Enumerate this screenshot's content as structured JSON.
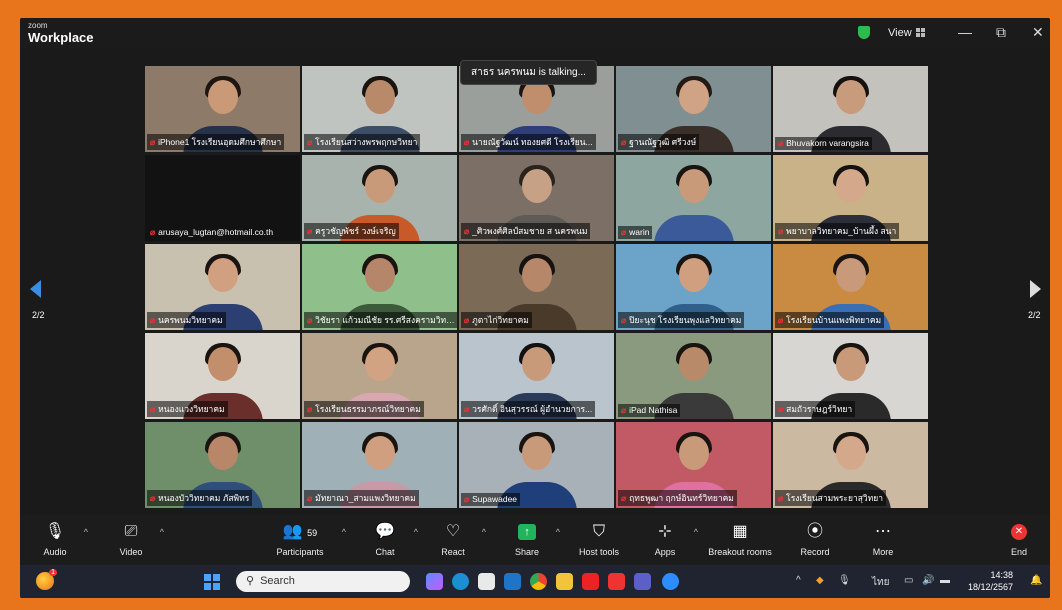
{
  "window": {
    "logo_small": "zoom",
    "logo_big": "Workplace",
    "view_label": "View",
    "minimize": "—",
    "restore": "⧉",
    "close": "✕"
  },
  "speaker": {
    "text": "สาธร นครพนม is talking..."
  },
  "pager": {
    "left": "2/2",
    "right": "2/2"
  },
  "participants": [
    {
      "name": "iPhone1 โรงเรียนอุดมศึกษาศึกษา",
      "bg": "#8d7a68",
      "body": "#26324a",
      "hair": "#1d1512",
      "skin": "#c99978"
    },
    {
      "name": "โรงเรียนสว่างพรพฤกษวิทยา",
      "bg": "#bfc4c0",
      "body": "#3d4f66",
      "hair": "#1a1411",
      "skin": "#b88a6a"
    },
    {
      "name": "นายณัฐวัฒน์ ทองยศดี โรงเรียน...",
      "bg": "#9a9f9c",
      "body": "#2e3f78",
      "hair": "#1a1411",
      "skin": "#c08e6d"
    },
    {
      "name": "ฐานณัฐวุฒิ ศรีวงษ์",
      "bg": "#7f8f92",
      "body": "#3b2f2a",
      "hair": "#241a15",
      "skin": "#d0a385"
    },
    {
      "name": "Bhuvakorn varangsira",
      "bg": "#c4c2bc",
      "body": "#2b2b30",
      "hair": "#15110f",
      "skin": "#c79b7c"
    },
    {
      "name": "arusaya_lugtan@hotmail.co.th",
      "bg": "#121212",
      "body": "#121212",
      "hair": "#121212",
      "skin": "#121212"
    },
    {
      "name": "ครูวชัญพัชร์ วงษ์เจริญ",
      "bg": "#a9b3ad",
      "body": "#c85a2a",
      "hair": "#1a1411",
      "skin": "#c99a7a"
    },
    {
      "name": "_ศิวพงศ์ศิลป์สมชาย ส นครพนม",
      "bg": "#7c6f66",
      "body": "#5e5a56",
      "hair": "#2a221d",
      "skin": "#c7a185"
    },
    {
      "name": "warin",
      "bg": "#8da6a0",
      "body": "#3a5a9a",
      "hair": "#1a1411",
      "skin": "#c99a7a"
    },
    {
      "name": "พยาบาลวิทยาคม_บ้านผึ้ง สนา",
      "bg": "#c9b188",
      "body": "#2a2f3a",
      "hair": "#15110f",
      "skin": "#d4a98b"
    },
    {
      "name": "นครพนมวิทยาคม",
      "bg": "#c9c1b0",
      "body": "#2b3f73",
      "hair": "#1a1411",
      "skin": "#d0a080"
    },
    {
      "name": "วิชัยรา แก้วมณีชัย รร.ศรีสงครามวิทยาคม",
      "bg": "#8fbf8a",
      "body": "#3c5b3a",
      "hair": "#1a1411",
      "skin": "#b5866a"
    },
    {
      "name": "ภูตาไก่วิทยาคม",
      "bg": "#7b6a56",
      "body": "#4a3a2a",
      "hair": "#171210",
      "skin": "#b7876a"
    },
    {
      "name": "ปิยะนุช โรงเรียนพุงแลวิทยาคม",
      "bg": "#6ba4c8",
      "body": "#2f5f8a",
      "hair": "#1a1411",
      "skin": "#cf9f80"
    },
    {
      "name": "โรงเรียนบ้านแพงพิทยาคม",
      "bg": "#c98a42",
      "body": "#3a6fb5",
      "hair": "#1a1411",
      "skin": "#c99a7a"
    },
    {
      "name": "หนองแวงวิทยาคม",
      "bg": "#d9d4cc",
      "body": "#6a2f2a",
      "hair": "#1a1411",
      "skin": "#c28e6c"
    },
    {
      "name": "โรงเรียนธรรมาภรณ์วิทยาคม",
      "bg": "#b8a58c",
      "body": "#d9a7b0",
      "hair": "#1a1411",
      "skin": "#d1a383"
    },
    {
      "name": "วรศักดิ์ อินสุวรรณ์ ผู้อำนวยการ...",
      "bg": "#b9c4cc",
      "body": "#2a3a5a",
      "hair": "#111",
      "skin": "#c99a7a"
    },
    {
      "name": "iPad Nathisa",
      "bg": "#8a9a7f",
      "body": "#3a3a3a",
      "hair": "#1a1411",
      "skin": "#b88a6a"
    },
    {
      "name": "สมถัวราษฎร์วิทยา",
      "bg": "#d8d6d2",
      "body": "#2a2a2a",
      "hair": "#1a1411",
      "skin": "#c99a7a"
    },
    {
      "name": "หนองบัววิทยาคม ภัสพิทร",
      "bg": "#6f8f6a",
      "body": "#2f4e7a",
      "hair": "#1a1411",
      "skin": "#b8876a"
    },
    {
      "name": "มัทยาณา_สามแพงวิทยาคม",
      "bg": "#9fb0b6",
      "body": "#c79aa8",
      "hair": "#1a1411",
      "skin": "#cf9f80"
    },
    {
      "name": "Supawadee",
      "bg": "#a9b1b8",
      "body": "#1f3f7a",
      "hair": "#1a1411",
      "skin": "#c99a7a"
    },
    {
      "name": "ฤทธพูฒา ฤกษ์อินทร์วิทยาคม",
      "bg": "#c25a66",
      "body": "#e070a0",
      "hair": "#1a1411",
      "skin": "#c99a7a"
    },
    {
      "name": "โรงเรียนสามพระยาสุวิทยา",
      "bg": "#cbb9a2",
      "body": "#2a2a2a",
      "hair": "#1a1411",
      "skin": "#d4a98b"
    }
  ],
  "toolbar": {
    "audio": "Audio",
    "video": "Video",
    "participants": "Participants",
    "participants_count": "59",
    "chat": "Chat",
    "react": "React",
    "share": "Share",
    "host_tools": "Host tools",
    "apps": "Apps",
    "breakout_rooms": "Breakout rooms",
    "record": "Record",
    "more": "More",
    "end": "End"
  },
  "taskbar": {
    "search_placeholder": "Search",
    "badge_count": "1",
    "lang": "ไทย",
    "time": "14:38",
    "date": "18/12/2567"
  }
}
